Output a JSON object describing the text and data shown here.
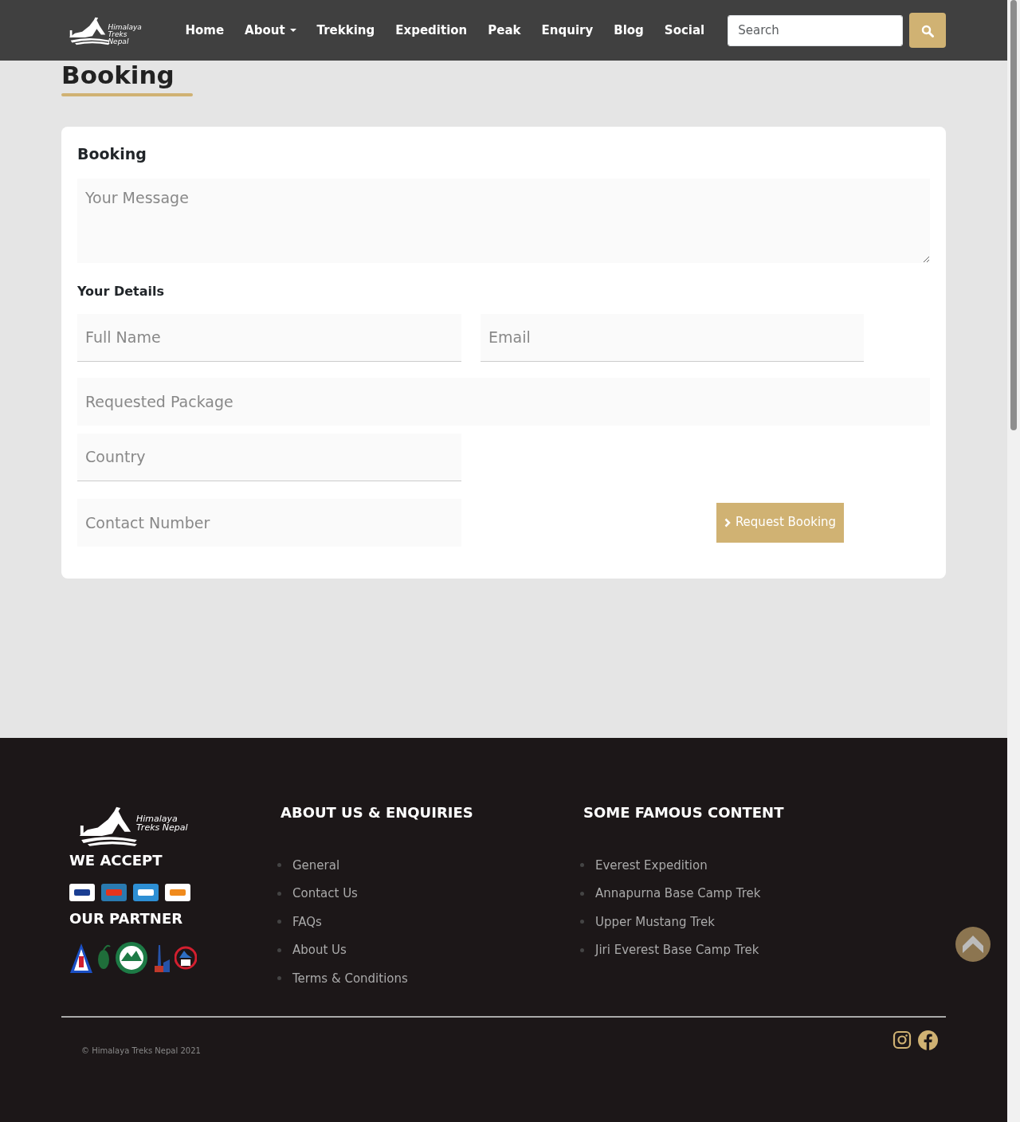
{
  "navbar": {
    "logo": {
      "line1": "Himalaya",
      "line2": "Treks Nepal"
    },
    "links": [
      {
        "label": "Home",
        "dropdown": false
      },
      {
        "label": "About",
        "dropdown": true
      },
      {
        "label": "Trekking",
        "dropdown": false
      },
      {
        "label": "Expedition",
        "dropdown": false
      },
      {
        "label": "Peak",
        "dropdown": false
      },
      {
        "label": "Enquiry",
        "dropdown": false
      },
      {
        "label": "Blog",
        "dropdown": false
      },
      {
        "label": "Social",
        "dropdown": false
      }
    ],
    "search": {
      "placeholder": "Search"
    }
  },
  "page_title": "Booking",
  "form": {
    "title": "Booking",
    "message": {
      "placeholder": "Your Message"
    },
    "details_heading": "Your Details",
    "full_name": {
      "placeholder": "Full Name"
    },
    "email": {
      "placeholder": "Email"
    },
    "package": {
      "placeholder": "Requested Package"
    },
    "country": {
      "placeholder": "Country"
    },
    "contact": {
      "placeholder": "Contact Number"
    },
    "submit": "Request Booking"
  },
  "footer": {
    "logo": {
      "line1": "Himalaya",
      "line2": "Treks Nepal"
    },
    "we_accept": "WE ACCEPT",
    "our_partner": "OUR PARTNER",
    "columns": [
      {
        "heading": "ABOUT US & ENQUIRIES",
        "links": [
          "General",
          "Contact Us",
          "FAQs",
          "About Us",
          "Terms & Conditions"
        ]
      },
      {
        "heading": "SOME FAMOUS CONTENT",
        "links": [
          "Everest Expedition",
          "Annapurna Base Camp Trek",
          "Upper Mustang Trek",
          "Jiri Everest Base Camp Trek"
        ]
      }
    ],
    "copyright": "© Himalaya Treks Nepal 2021"
  }
}
